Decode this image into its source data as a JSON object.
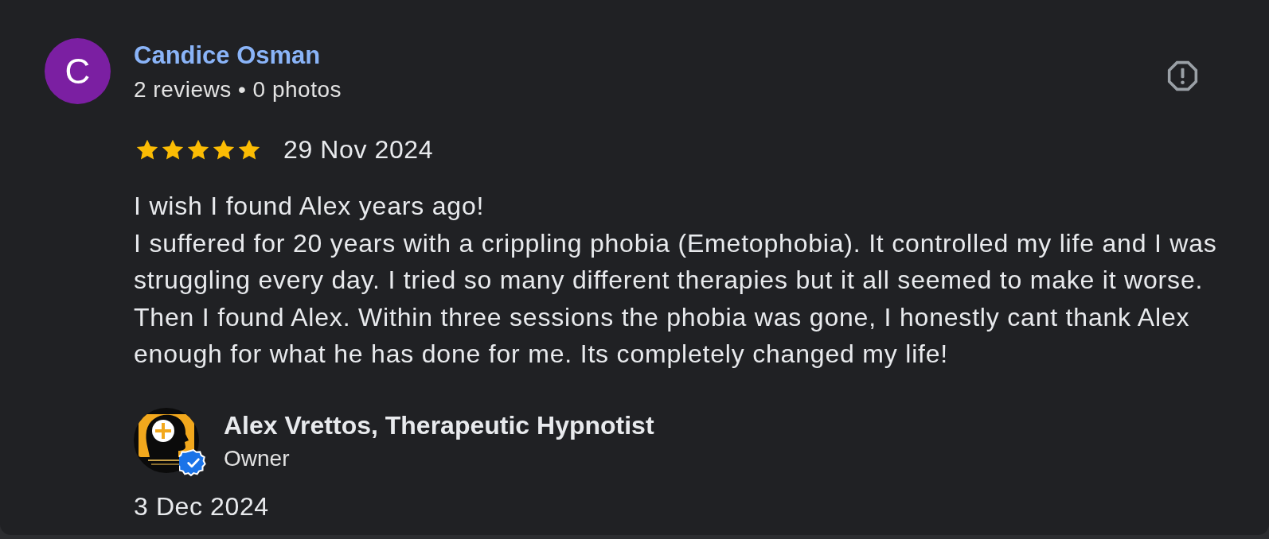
{
  "reviewer": {
    "initial": "C",
    "name": "Candice Osman",
    "stats": "2 reviews • 0 photos"
  },
  "review": {
    "stars": 5,
    "date": "29 Nov 2024",
    "lines": [
      "I wish I found Alex years ago!",
      "I suffered for 20 years with a crippling phobia (Emetophobia). It controlled my life and I was",
      "struggling every day. I tried so many different therapies but it all seemed to make it worse.",
      "Then I found Alex. Within three sessions the phobia was gone, I honestly cant thank Alex",
      "enough for what he has done for me. Its completely changed my life!"
    ]
  },
  "owner_response": {
    "name": "Alex Vrettos, Therapeutic Hypnotist",
    "role": "Owner",
    "verified": true,
    "date": "3 Dec 2024"
  }
}
